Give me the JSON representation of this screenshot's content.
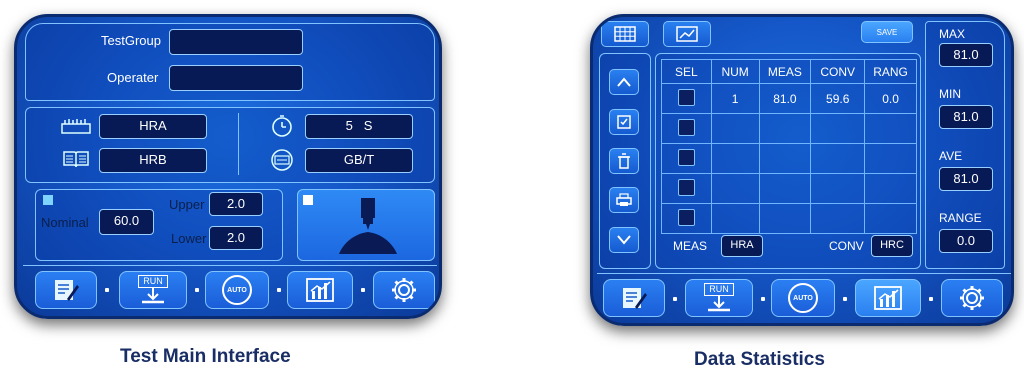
{
  "main": {
    "testgroup_label": "TestGroup",
    "testgroup_value": "",
    "operater_label": "Operater",
    "operater_value": "",
    "scale1": "HRA",
    "scale2": "HRB",
    "dwell_value": "5",
    "dwell_unit": "S",
    "standard": "GB/T",
    "nominal_label": "Nominal",
    "nominal_value": "60.0",
    "upper_label": "Upper",
    "upper_value": "2.0",
    "lower_label": "Lower",
    "lower_value": "2.0",
    "caption": "Test Main Interface"
  },
  "stats": {
    "save_label": "SAVE",
    "columns": [
      "SEL",
      "NUM",
      "MEAS",
      "CONV",
      "RANG"
    ],
    "rows": [
      {
        "num": "1",
        "meas": "81.0",
        "conv": "59.6",
        "rang": "0.0"
      },
      {
        "num": "",
        "meas": "",
        "conv": "",
        "rang": ""
      },
      {
        "num": "",
        "meas": "",
        "conv": "",
        "rang": ""
      },
      {
        "num": "",
        "meas": "",
        "conv": "",
        "rang": ""
      },
      {
        "num": "",
        "meas": "",
        "conv": "",
        "rang": ""
      }
    ],
    "meas_label": "MEAS",
    "meas_scale": "HRA",
    "conv_label": "CONV",
    "conv_scale": "HRC",
    "max_label": "MAX",
    "max_value": "81.0",
    "min_label": "MIN",
    "min_value": "81.0",
    "ave_label": "AVE",
    "ave_value": "81.0",
    "range_label": "RANGE",
    "range_value": "0.0",
    "caption": "Data Statistics"
  },
  "nav": {
    "run_label": "RUN",
    "auto_label": "AUTO"
  },
  "icons": [
    "edit-icon",
    "run-icon",
    "auto-icon",
    "chart-icon",
    "gear-icon",
    "hardness-icon",
    "book-icon",
    "timer-icon",
    "standard-icon",
    "grid-icon",
    "up-icon",
    "select-all-icon",
    "delete-icon",
    "print-icon",
    "down-icon"
  ],
  "colors": {
    "panel": "#1557c8",
    "field": "#081a55",
    "border": "#7fc4ff",
    "caption": "#1a2e66"
  }
}
